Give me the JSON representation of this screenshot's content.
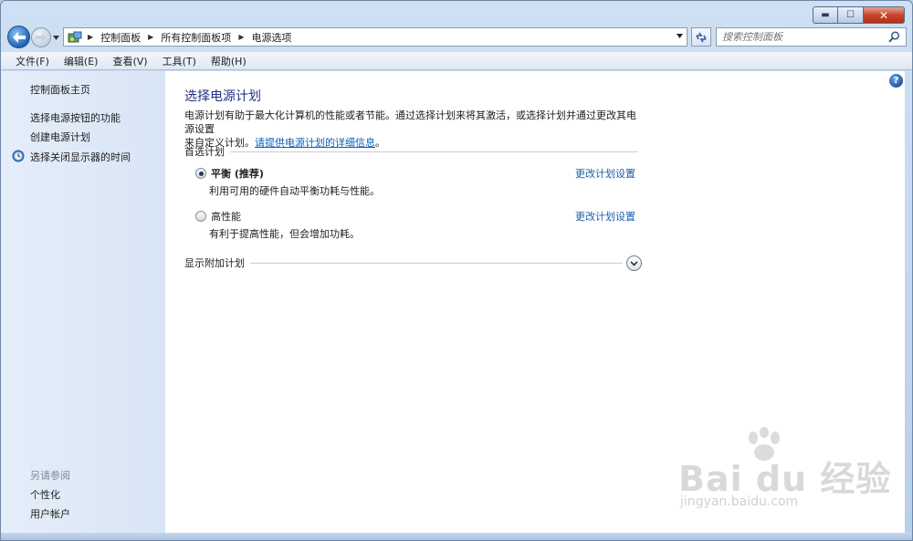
{
  "window": {
    "caption_buttons": {
      "minimize": "▬",
      "maximize": "☐",
      "close": "✕"
    }
  },
  "navigation": {
    "breadcrumbs": [
      "控制面板",
      "所有控制面板项",
      "电源选项"
    ],
    "search_placeholder": "搜索控制面板"
  },
  "menu": [
    "文件(F)",
    "编辑(E)",
    "查看(V)",
    "工具(T)",
    "帮助(H)"
  ],
  "sidebar": {
    "home": "控制面板主页",
    "links": [
      "选择电源按钮的功能",
      "创建电源计划",
      "选择关闭显示器的时间"
    ],
    "see_also_header": "另请参阅",
    "see_also": [
      "个性化",
      "用户帐户"
    ]
  },
  "main": {
    "title": "选择电源计划",
    "description_line1": "电源计划有助于最大化计算机的性能或者节能。通过选择计划来将其激活，或选择计划并通过更改其电源设置",
    "description_line2": "来自定义计划。",
    "description_link": "请提供电源计划的详细信息",
    "description_end": "。",
    "preferred_header": "首选计划",
    "plans": [
      {
        "name": "平衡 (推荐)",
        "description": "利用可用的硬件自动平衡功耗与性能。",
        "change_link": "更改计划设置",
        "selected": true
      },
      {
        "name": "高性能",
        "description": "有利于提高性能，但会增加功耗。",
        "change_link": "更改计划设置",
        "selected": false
      }
    ],
    "additional_header": "显示附加计划"
  },
  "watermark": {
    "text": "Bai du 经验",
    "sub": "jingyan.baidu.com"
  },
  "colors": {
    "title": "#1e3287",
    "link": "#0b5fbd",
    "sidebar_bg": "#dce8f6"
  }
}
